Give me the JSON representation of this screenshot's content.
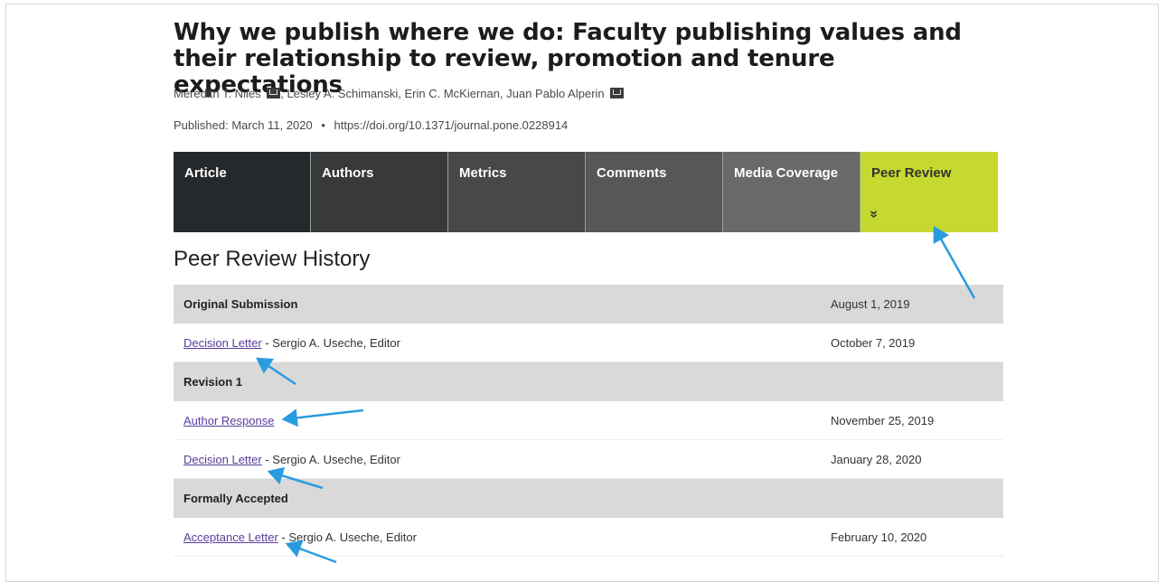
{
  "article": {
    "title": "Why we publish where we do: Faculty publishing values and their relationship to review, promotion and tenure expectations",
    "authors": [
      {
        "name": "Meredith T. Niles",
        "has_email": true
      },
      {
        "name": "Lesley A. Schimanski",
        "has_email": false
      },
      {
        "name": "Erin C. McKiernan",
        "has_email": false
      },
      {
        "name": "Juan Pablo Alperin",
        "has_email": true
      }
    ],
    "published": "Published: March 11, 2020",
    "separator": "•",
    "doi": "https://doi.org/10.1371/journal.pone.0228914"
  },
  "tabs": [
    {
      "label": "Article",
      "color": "#26292b"
    },
    {
      "label": "Authors",
      "color": "#37393b"
    },
    {
      "label": "Metrics",
      "color": "#46484a"
    },
    {
      "label": "Comments",
      "color": "#555759"
    },
    {
      "label": "Media Coverage",
      "color": "#67696b"
    },
    {
      "label": "Peer Review",
      "color": "#c6d92e",
      "active": true,
      "text_color": "#333333",
      "indicator": "»"
    }
  ],
  "peer_review": {
    "heading": "Peer Review History",
    "rows": [
      {
        "type": "section",
        "label": "Original Submission",
        "date": "August 1, 2019"
      },
      {
        "type": "item",
        "link": "Decision Letter",
        "suffix": " - Sergio A. Useche, Editor",
        "date": "October 7, 2019"
      },
      {
        "type": "section",
        "label": "Revision 1",
        "date": ""
      },
      {
        "type": "item",
        "link": "Author Response",
        "suffix": "",
        "date": "November 25, 2019"
      },
      {
        "type": "item",
        "link": "Decision Letter",
        "suffix": " - Sergio A. Useche, Editor",
        "date": "January 28, 2020"
      },
      {
        "type": "section",
        "label": "Formally Accepted",
        "date": ""
      },
      {
        "type": "item",
        "link": "Acceptance Letter",
        "suffix": " - Sergio A. Useche, Editor",
        "date": "February 10, 2020"
      }
    ]
  },
  "colors": {
    "annotation_arrow": "#2b9be0",
    "section_row_bg": "#d9d9d9",
    "link": "#5a3d9c"
  }
}
